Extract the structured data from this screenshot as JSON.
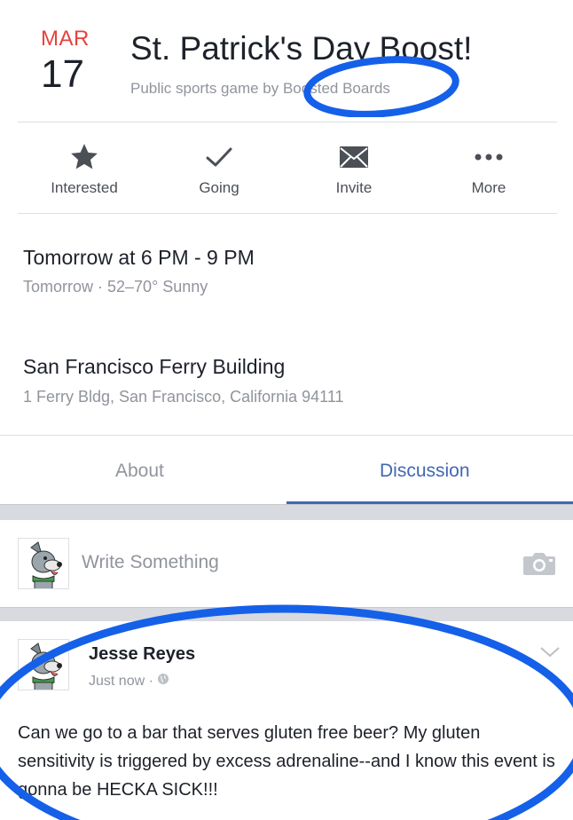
{
  "event": {
    "month": "MAR",
    "day": "17",
    "title": "St. Patrick's Day Boost!",
    "subtitle": "Public sports game by Boosted Boards"
  },
  "actions": [
    {
      "label": "Interested",
      "icon": "star-icon"
    },
    {
      "label": "Going",
      "icon": "checkmark-icon"
    },
    {
      "label": "Invite",
      "icon": "envelope-icon"
    },
    {
      "label": "More",
      "icon": "more-dots-icon"
    }
  ],
  "details": {
    "time_main": "Tomorrow at 6 PM - 9 PM",
    "time_sub": "Tomorrow · 52–70° Sunny",
    "location_main": "San Francisco Ferry Building",
    "location_sub": "1 Ferry Bldg, San Francisco, California 94111"
  },
  "tabs": {
    "about": "About",
    "discussion": "Discussion",
    "active": "Discussion"
  },
  "composer": {
    "placeholder": "Write Something"
  },
  "post": {
    "author": "Jesse Reyes",
    "time": "Just now ·",
    "text": "Can we go to a bar that serves gluten free beer? My gluten sensitivity is triggered by excess adrenaline--and I know this event is gonna be HECKA SICK!!!"
  },
  "colors": {
    "accent": "#4267b2",
    "date_red": "#e8413c",
    "annotation_blue": "#1560e8"
  }
}
